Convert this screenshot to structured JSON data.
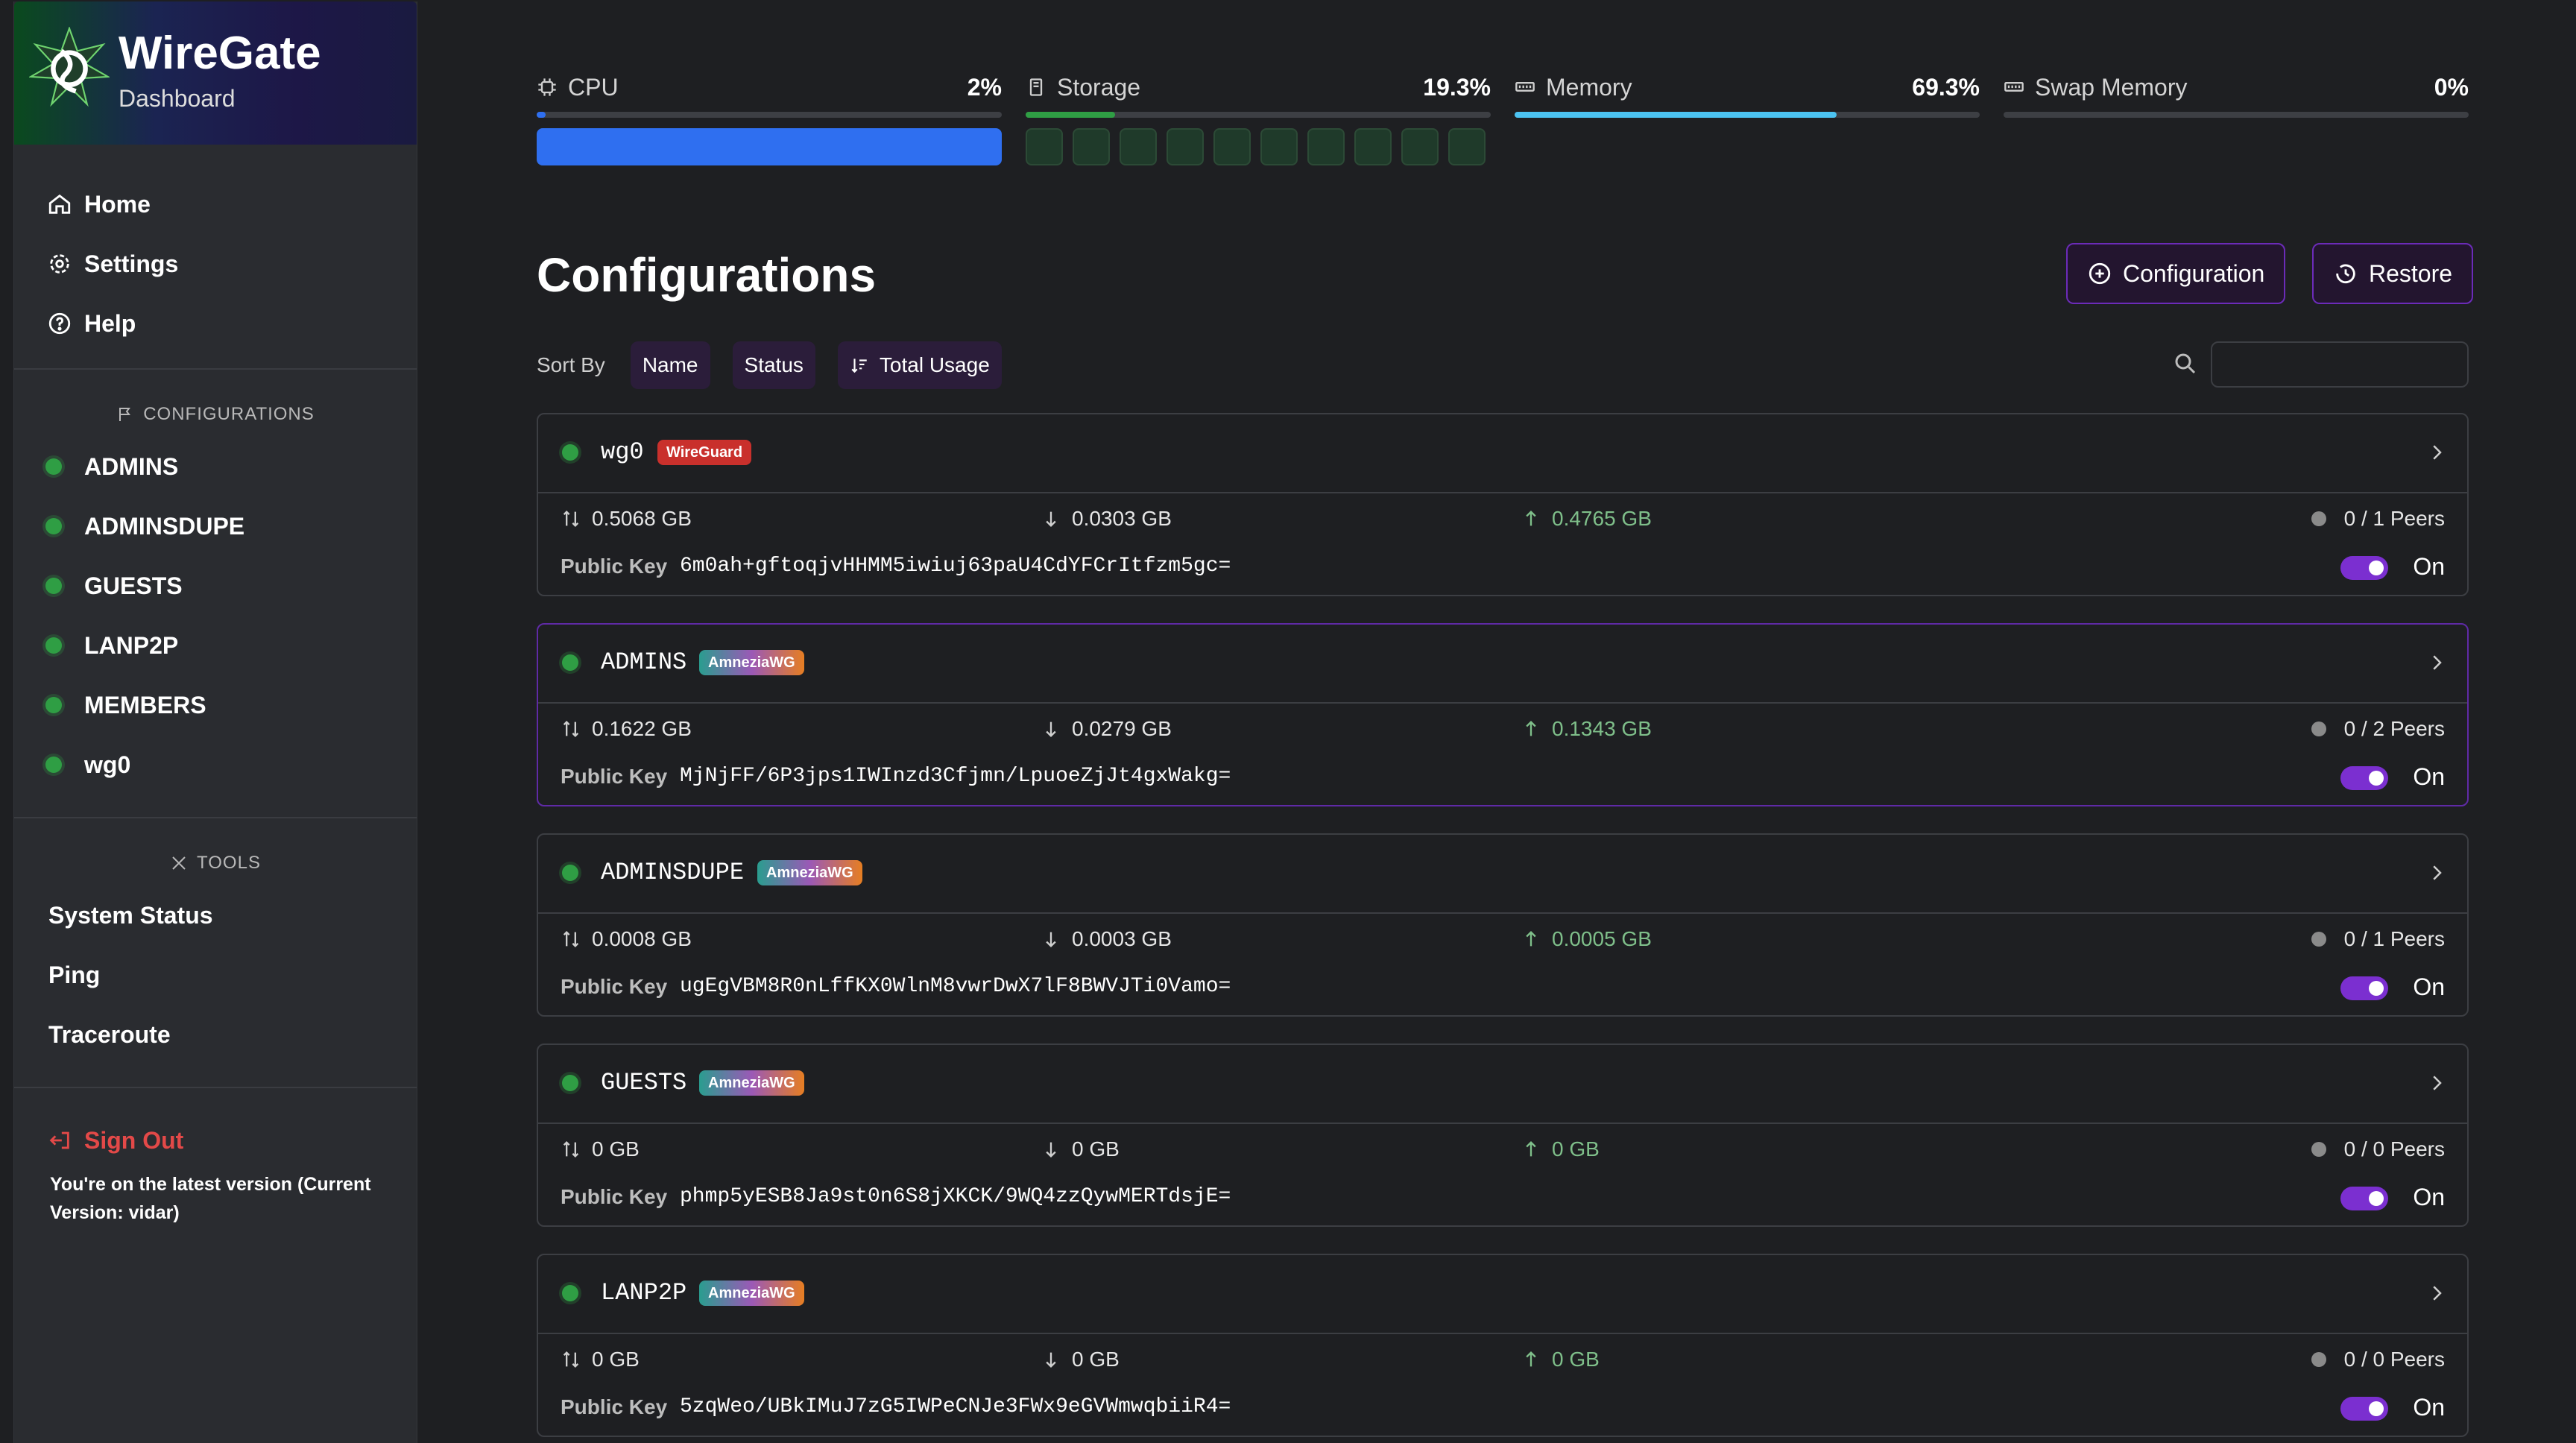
{
  "brand": {
    "title": "WireGate",
    "subtitle": "Dashboard"
  },
  "nav": [
    {
      "label": "Home",
      "icon": "home-icon"
    },
    {
      "label": "Settings",
      "icon": "gear-icon"
    },
    {
      "label": "Help",
      "icon": "help-icon"
    }
  ],
  "sidebar": {
    "configurations_label": "CONFIGURATIONS",
    "configurations": [
      "ADMINS",
      "ADMINSDUPE",
      "GUESTS",
      "LANP2P",
      "MEMBERS",
      "wg0"
    ],
    "tools_label": "TOOLS",
    "tools": [
      "System Status",
      "Ping",
      "Traceroute"
    ],
    "signout": "Sign Out",
    "version_text": "You're on the latest version (Current Version: vidar)"
  },
  "stats": {
    "cpu": {
      "label": "CPU",
      "value": "2%",
      "percent": 2
    },
    "storage": {
      "label": "Storage",
      "value": "19.3%",
      "percent": 19.3
    },
    "memory": {
      "label": "Memory",
      "value": "69.3%",
      "percent": 69.3
    },
    "swap": {
      "label": "Swap Memory",
      "value": "0%",
      "percent": 0
    }
  },
  "page": {
    "title": "Configurations",
    "btn_configuration": "Configuration",
    "btn_restore": "Restore",
    "sort_by": "Sort By",
    "sort_name": "Name",
    "sort_status": "Status",
    "sort_total": "Total Usage",
    "search_placeholder": ""
  },
  "cards": [
    {
      "name": "wg0",
      "tag": "WireGuard",
      "total": "0.5068 GB",
      "down": "0.0303 GB",
      "up": "0.4765 GB",
      "peers": "0 / 1 Peers",
      "public_key_label": "Public Key",
      "public_key": "6m0ah+gftoqjvHHMM5iwiuj63paU4CdYFCrItfzm5gc=",
      "toggle": "On"
    },
    {
      "name": "ADMINS",
      "tag": "AmneziaWG",
      "total": "0.1622 GB",
      "down": "0.0279 GB",
      "up": "0.1343 GB",
      "peers": "0 / 2 Peers",
      "public_key_label": "Public Key",
      "public_key": "MjNjFF/6P3jps1IWInzd3Cfjmn/LpuoeZjJt4gxWakg=",
      "toggle": "On"
    },
    {
      "name": "ADMINSDUPE",
      "tag": "AmneziaWG",
      "total": "0.0008 GB",
      "down": "0.0003 GB",
      "up": "0.0005 GB",
      "peers": "0 / 1 Peers",
      "public_key_label": "Public Key",
      "public_key": "ugEgVBM8R0nLffKX0WlnM8vwrDwX7lF8BWVJTi0Vamo=",
      "toggle": "On"
    },
    {
      "name": "GUESTS",
      "tag": "AmneziaWG",
      "total": "0 GB",
      "down": "0 GB",
      "up": "0 GB",
      "peers": "0 / 0 Peers",
      "public_key_label": "Public Key",
      "public_key": "phmp5yESB8Ja9st0n6S8jXKCK/9WQ4zzQywMERTdsjE=",
      "toggle": "On"
    },
    {
      "name": "LANP2P",
      "tag": "AmneziaWG",
      "total": "0 GB",
      "down": "0 GB",
      "up": "0 GB",
      "peers": "0 / 0 Peers",
      "public_key_label": "Public Key",
      "public_key": "5zqWeo/UBkIMuJ7zG5IWPeCNJe3FWx9eGVWmwqbiiR4=",
      "toggle": "On"
    }
  ],
  "colors": {
    "accent": "#7b2fd0",
    "status_green": "#2f9e44",
    "cpu_bar": "#2f6ff0",
    "memory_bar": "#4cc3f2",
    "storage_bar": "#2f9e44"
  }
}
